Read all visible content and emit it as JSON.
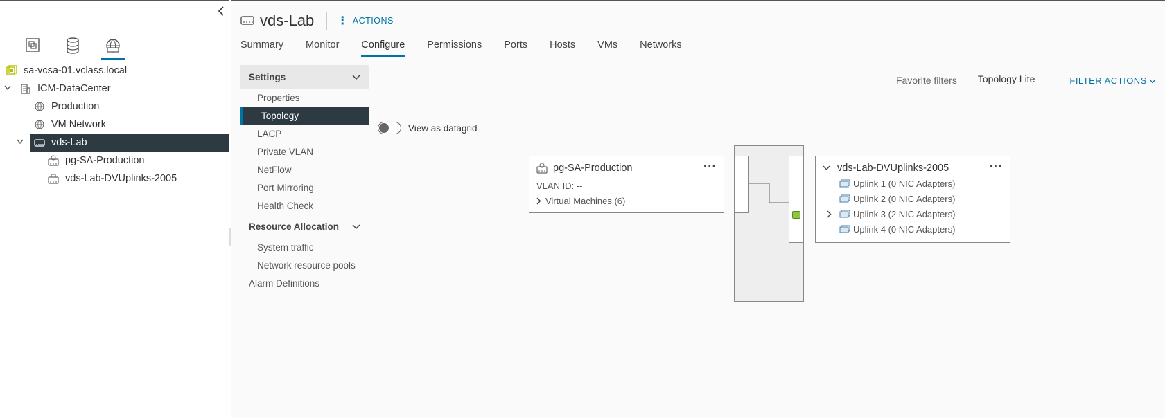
{
  "navigator": {
    "collapse_icon": "chevron-left-icon",
    "icons": [
      "hosts-clusters-icon",
      "storage-icon",
      "networking-icon"
    ],
    "tree": [
      {
        "label": "sa-vcsa-01.vclass.local",
        "icon": "vcenter-icon"
      },
      {
        "label": "ICM-DataCenter",
        "icon": "datacenter-icon",
        "expanded": true
      },
      {
        "label": "Production",
        "icon": "network-icon"
      },
      {
        "label": "VM Network",
        "icon": "network-icon"
      },
      {
        "label": "vds-Lab",
        "icon": "distributed-switch-icon",
        "expanded": true,
        "selected": true
      },
      {
        "label": "pg-SA-Production",
        "icon": "portgroup-icon"
      },
      {
        "label": "vds-Lab-DVUplinks-2005",
        "icon": "uplink-portgroup-icon"
      }
    ]
  },
  "header": {
    "title": "vds-Lab",
    "actions_label": "ACTIONS"
  },
  "tabs": [
    {
      "label": "Summary"
    },
    {
      "label": "Monitor"
    },
    {
      "label": "Configure",
      "active": true
    },
    {
      "label": "Permissions"
    },
    {
      "label": "Ports"
    },
    {
      "label": "Hosts"
    },
    {
      "label": "VMs"
    },
    {
      "label": "Networks"
    }
  ],
  "settings_nav": {
    "settings_heading": "Settings",
    "settings_items": [
      "Properties",
      "Topology",
      "LACP",
      "Private VLAN",
      "NetFlow",
      "Port Mirroring",
      "Health Check"
    ],
    "active_item": "Topology",
    "resource_heading": "Resource Allocation",
    "resource_items": [
      "System traffic",
      "Network resource pools"
    ],
    "alarm_item": "Alarm Definitions"
  },
  "filters": {
    "favorite": "Favorite filters",
    "topology": "Topology Lite",
    "filter_actions": "FILTER ACTIONS"
  },
  "toggle": {
    "label": "View as datagrid",
    "on": false
  },
  "topology": {
    "portgroup": {
      "name": "pg-SA-Production",
      "vlan": "VLAN ID: --",
      "vms": "Virtual Machines (6)"
    },
    "uplinks": {
      "name": "vds-Lab-DVUplinks-2005",
      "items": [
        "Uplink 1 (0 NIC Adapters)",
        "Uplink 2 (0 NIC Adapters)",
        "Uplink 3 (2 NIC Adapters)",
        "Uplink 4 (0 NIC Adapters)"
      ]
    },
    "colors": {
      "active_port": "#8dc63f",
      "selected_bg": "#2e3a42",
      "accent": "#0072a3"
    }
  }
}
